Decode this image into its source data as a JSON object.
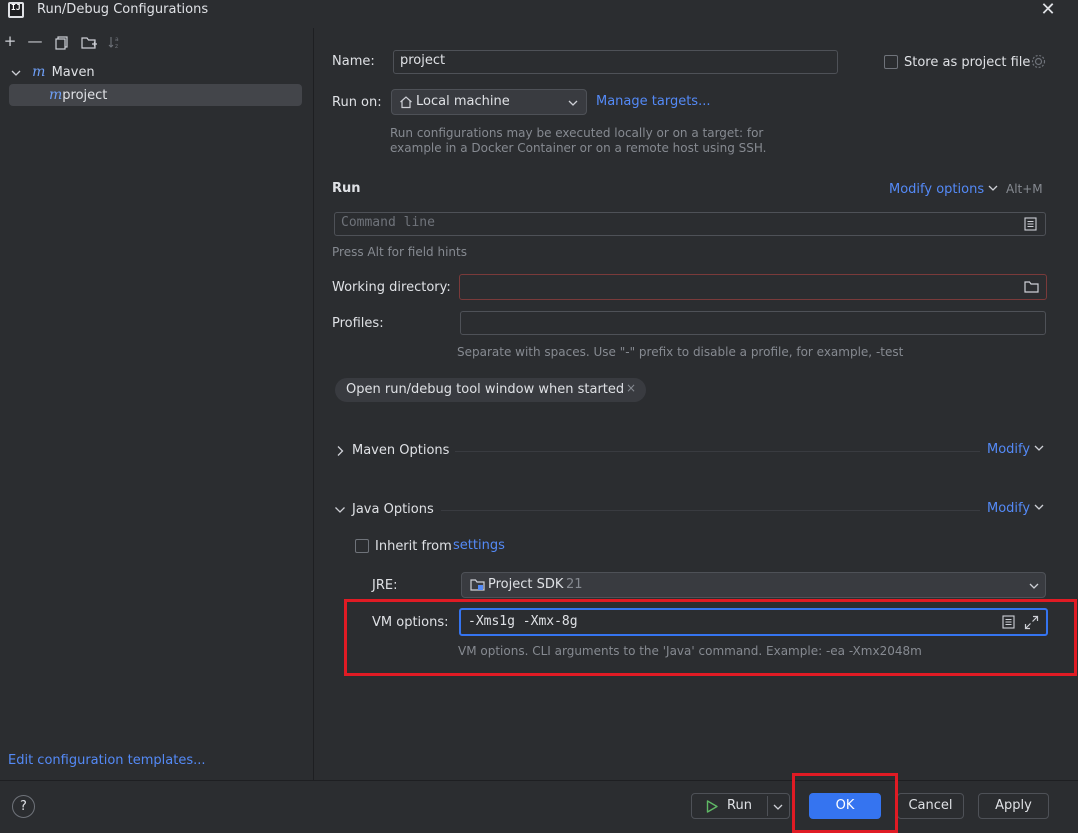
{
  "window": {
    "title": "Run/Debug Configurations"
  },
  "toolbar": {
    "add_icon": "plus-icon",
    "remove_icon": "minus-icon",
    "copy_icon": "copy-icon",
    "folder_icon": "new-folder-icon",
    "sort_icon": "sort-alpha-icon"
  },
  "tree": {
    "group_label": "Maven",
    "item_label": "project"
  },
  "left_footer": {
    "edit_templates": "Edit configuration templates..."
  },
  "form": {
    "name_label": "Name:",
    "name_value": "project",
    "store_label": "Store as project file",
    "run_on_label": "Run on:",
    "run_on_value": "Local machine",
    "manage_targets": "Manage targets...",
    "run_on_hint_1": "Run configurations may be executed locally or on a target: for",
    "run_on_hint_2": "example in a Docker Container or on a remote host using SSH.",
    "run_section": "Run",
    "modify_options": "Modify options",
    "modify_shortcut": "Alt+M",
    "command_line_placeholder": "Command line",
    "field_hints": "Press Alt for field hints",
    "working_dir_label": "Working directory:",
    "profiles_label": "Profiles:",
    "profiles_hint": "Separate with spaces. Use \"-\" prefix to disable a profile, for example, -test",
    "chip_label": "Open run/debug tool window when started",
    "maven_options": "Maven Options",
    "java_options": "Java Options",
    "modify": "Modify",
    "inherit_label": "Inherit from",
    "inherit_link": "settings",
    "jre_label": "JRE:",
    "jre_value": "Project SDK",
    "jre_version": "21",
    "vm_label": "VM options:",
    "vm_value": "-Xms1g -Xmx-8g",
    "vm_hint": "VM options. CLI arguments to the 'Java' command. Example: -ea -Xmx2048m"
  },
  "buttons": {
    "help": "?",
    "run": "Run",
    "ok": "OK",
    "cancel": "Cancel",
    "apply": "Apply"
  },
  "colors": {
    "accent": "#3574f0",
    "link": "#548af7",
    "highlight_box": "#e01b24"
  }
}
